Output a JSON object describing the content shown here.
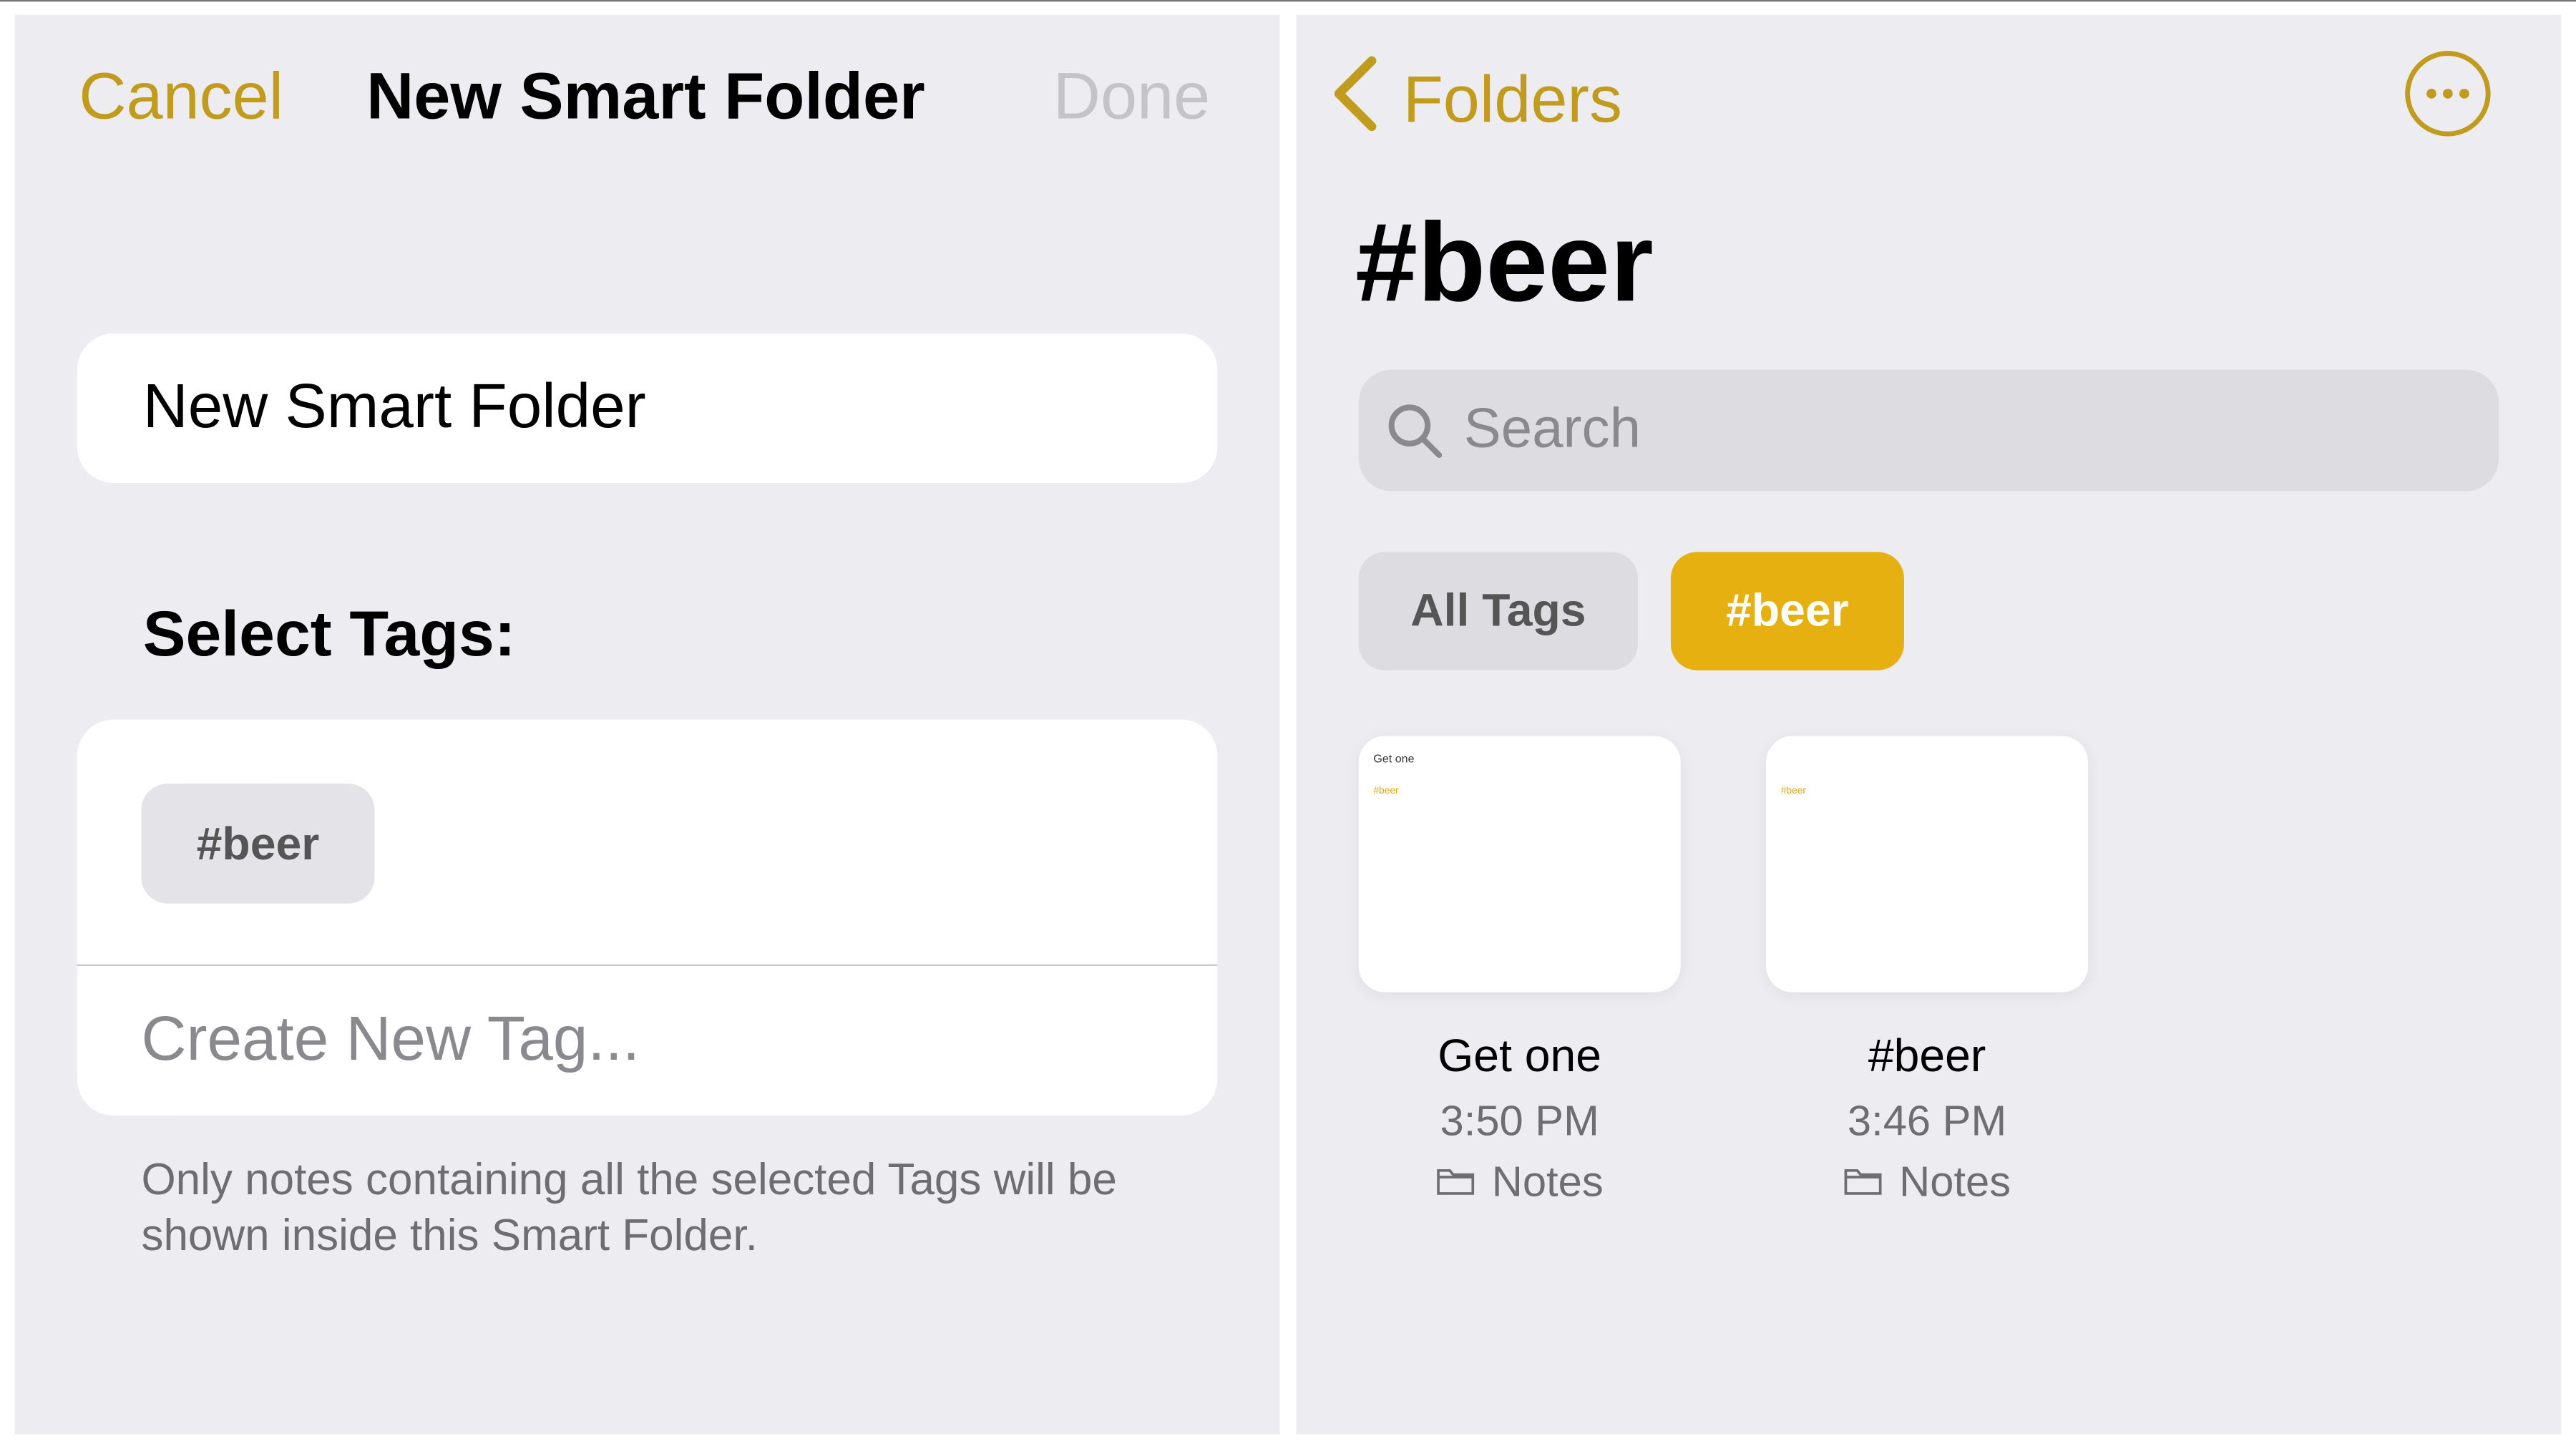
{
  "accent_color": "#c19b1c",
  "left": {
    "nav": {
      "cancel": "Cancel",
      "title": "New Smart Folder",
      "done": "Done"
    },
    "name_field_value": "New Smart Folder",
    "section_title": "Select Tags:",
    "tags": [
      "#beer"
    ],
    "create_tag_placeholder": "Create New Tag...",
    "footnote": "Only notes containing all the selected Tags will be shown inside this Smart Folder."
  },
  "right": {
    "back_label": "Folders",
    "more_icon": "ellipsis-circle-icon",
    "title": "#beer",
    "search_placeholder": "Search",
    "filters": [
      {
        "label": "All Tags",
        "selected": false
      },
      {
        "label": "#beer",
        "selected": true
      }
    ],
    "notes": [
      {
        "preview_title": "Get one",
        "preview_tag": "#beer",
        "title": "Get one",
        "time": "3:50 PM",
        "folder": "Notes"
      },
      {
        "preview_title": "",
        "preview_tag": "#beer",
        "title": "#beer",
        "time": "3:46 PM",
        "folder": "Notes"
      }
    ]
  }
}
